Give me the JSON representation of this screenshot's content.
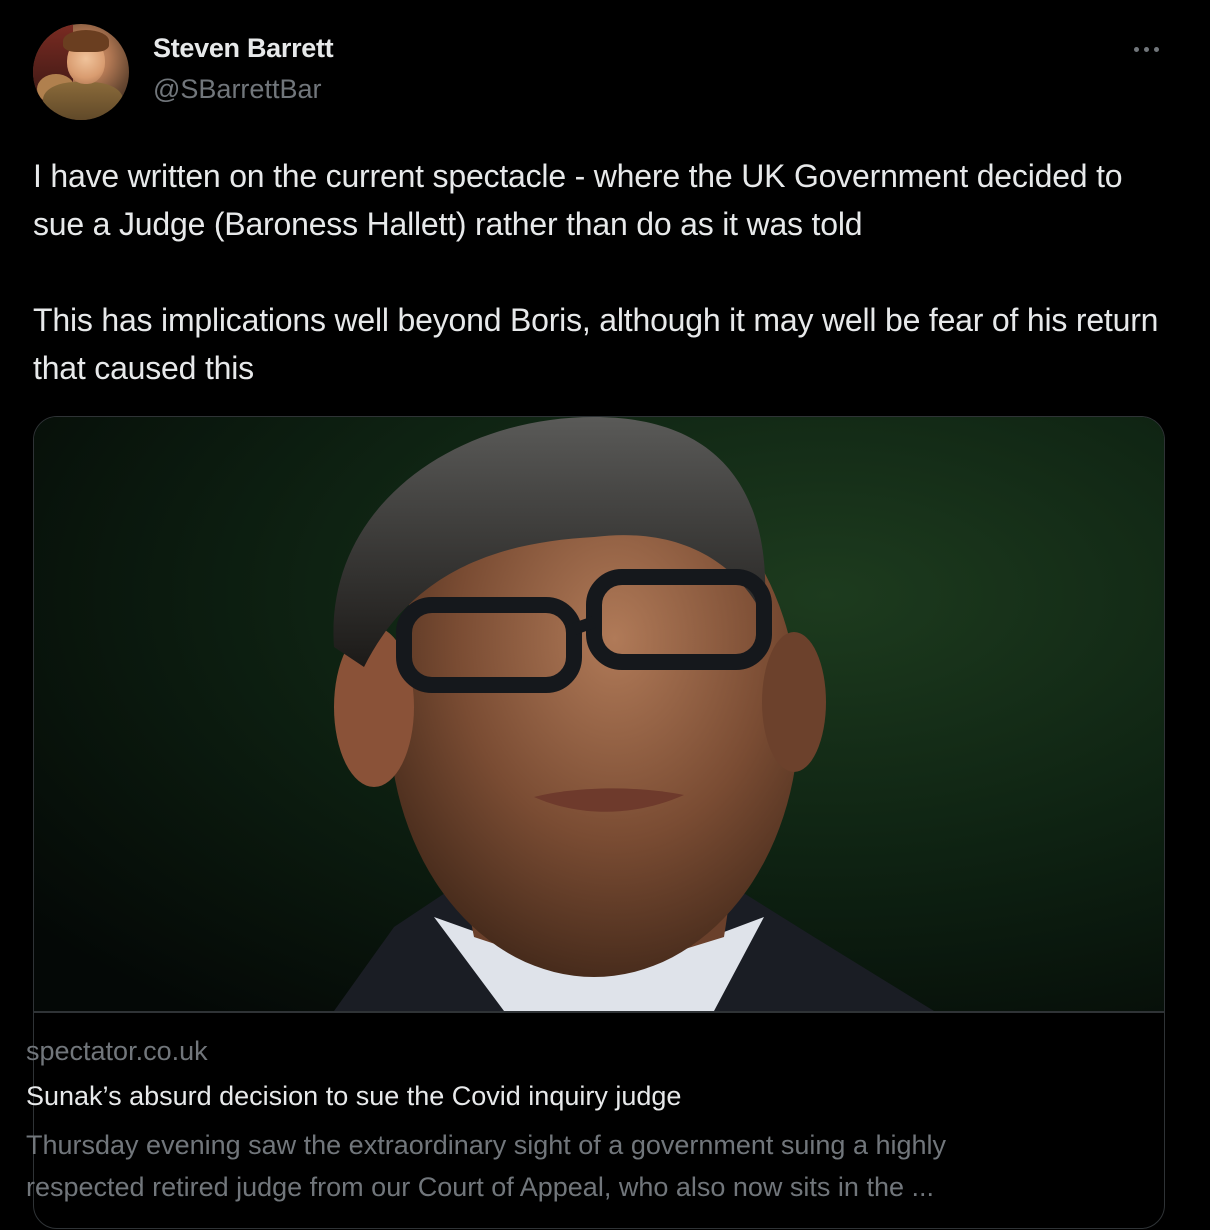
{
  "tweet": {
    "author": {
      "display_name": "Steven Barrett",
      "handle": "@SBarrettBar",
      "avatar_icon": "profile-photo"
    },
    "more_icon": "more-options-icon",
    "text": "I have written on the current spectacle - where the UK Government decided to sue a Judge (Baroness Hallett) rather than do as it was told\n\nThis has implications well beyond Boris, although it may well be fear of his return that caused this"
  },
  "link_card": {
    "image": "article-photo",
    "domain": "spectator.co.uk",
    "title": "Sunak’s absurd decision to sue the Covid inquiry judge",
    "description": "Thursday evening saw the extraordinary sight of a government suing a highly\nrespected retired judge from our Court of Appeal, who also now sits in the ..."
  },
  "colors": {
    "background": "#000000",
    "primary_text": "#e7e9ea",
    "secondary_text": "#71767b",
    "border": "#2f3336"
  }
}
